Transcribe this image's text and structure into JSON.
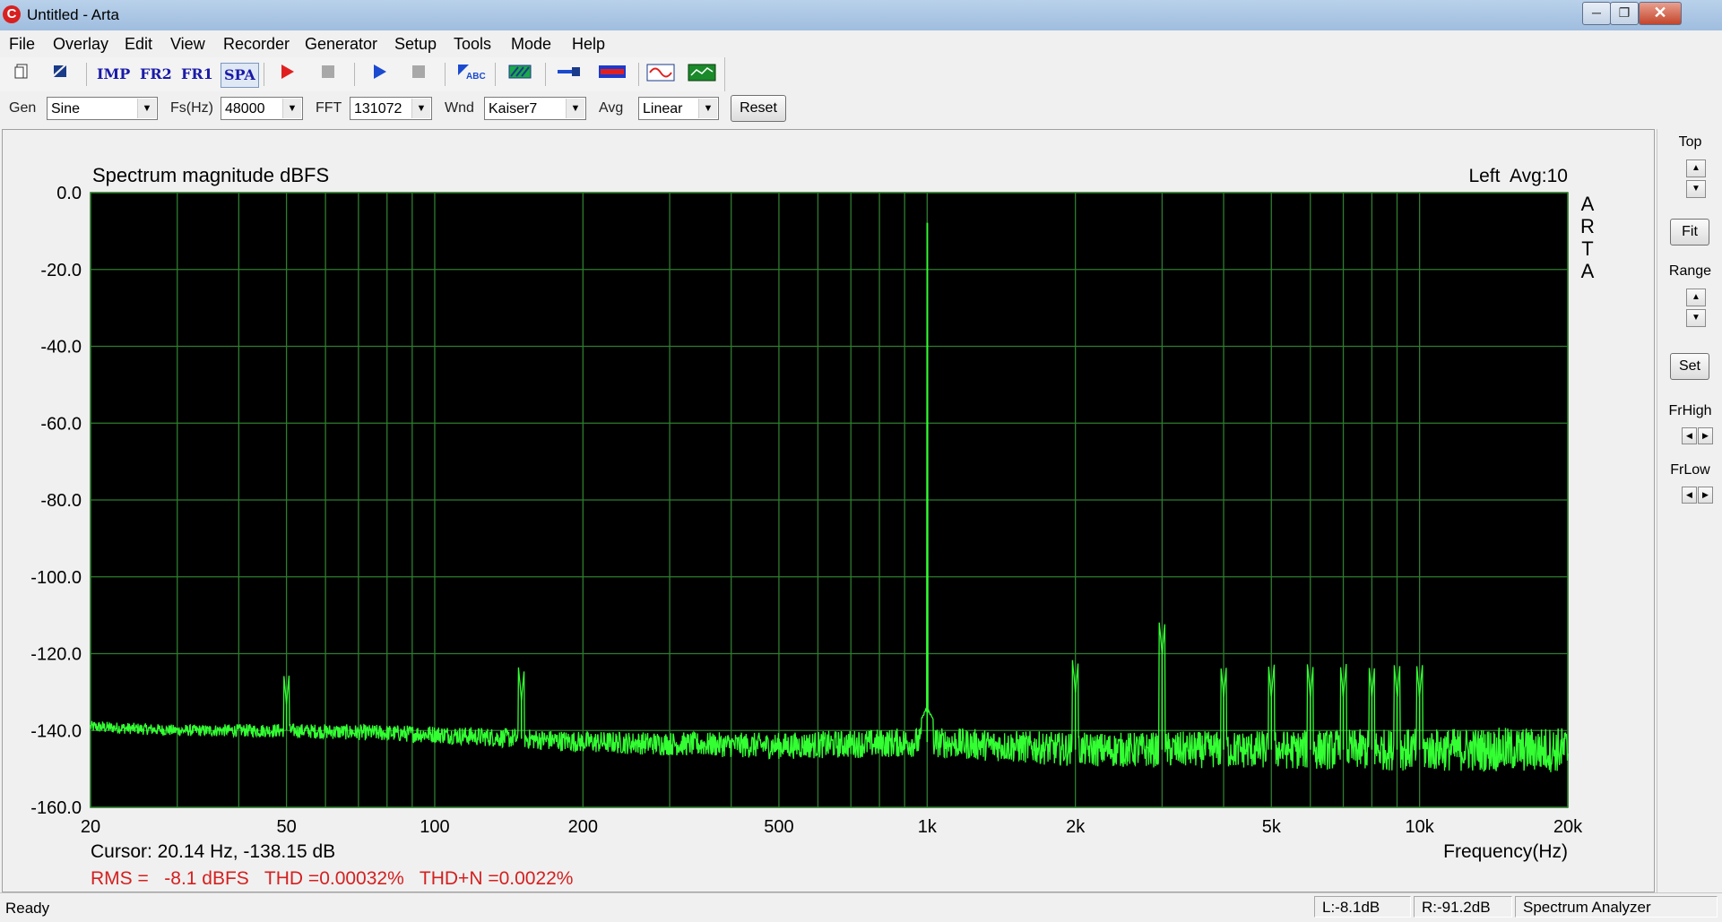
{
  "window": {
    "app_icon": "arta-icon",
    "title": "Untitled - Arta",
    "buttons": [
      "minimize",
      "restore",
      "close"
    ]
  },
  "menu": [
    "File",
    "Overlay",
    "Edit",
    "View",
    "Recorder",
    "Generator",
    "Setup",
    "Tools",
    "Mode",
    "Help"
  ],
  "toolbar": {
    "icons": [
      "new-file-icon",
      "open-icon",
      "imp-mode-icon",
      "fr2-mode-icon",
      "fr1-mode-icon",
      "spa-mode-icon",
      "record-icon",
      "stop-icon",
      "play-icon",
      "stop-icon",
      "abc-icon",
      "hatch-icon",
      "probe-icon",
      "spectrum-icon",
      "sine-icon",
      "scope-icon"
    ],
    "imp_label": "IMP",
    "fr2_label": "FR2",
    "fr1_label": "FR1",
    "spa_label": "SPA",
    "abc_label": "ABC"
  },
  "params": {
    "gen_label": "Gen",
    "gen_value": "Sine",
    "fs_label": "Fs(Hz)",
    "fs_value": "48000",
    "fft_label": "FFT",
    "fft_value": "131072",
    "wnd_label": "Wnd",
    "wnd_value": "Kaiser7",
    "avg_label": "Avg",
    "avg_value": "Linear",
    "reset_label": "Reset"
  },
  "right_panel": {
    "top_label": "Top",
    "fit_label": "Fit",
    "range_label": "Range",
    "set_label": "Set",
    "frhigh_label": "FrHigh",
    "frlow_label": "FrLow"
  },
  "chart_data": {
    "type": "line",
    "title": "Spectrum magnitude dBFS",
    "channel_info": "Left  Avg:10",
    "watermark": "ARTA",
    "xlabel": "Frequency(Hz)",
    "x_scale": "log",
    "xlim": [
      20,
      20000
    ],
    "ylim": [
      -160,
      0
    ],
    "x_tick_values": [
      20,
      50,
      100,
      200,
      500,
      1000,
      2000,
      5000,
      10000,
      20000
    ],
    "x_tick_labels": [
      "20",
      "50",
      "100",
      "200",
      "500",
      "1k",
      "2k",
      "5k",
      "10k",
      "20k"
    ],
    "y_tick_values": [
      0,
      -20,
      -40,
      -60,
      -80,
      -100,
      -120,
      -140,
      -160
    ],
    "y_tick_labels": [
      "0.0",
      "-20.0",
      "-40.0",
      "-60.0",
      "-80.0",
      "-100.0",
      "-120.0",
      "-140.0",
      "-160.0"
    ],
    "grid": true,
    "background": "#000000",
    "grid_color": "#2e7d2e",
    "trace_color": "#33ff33",
    "series": [
      {
        "noise_floor": [
          [
            20,
            -139
          ],
          [
            30,
            -140
          ],
          [
            50,
            -140
          ],
          [
            100,
            -141
          ],
          [
            200,
            -143
          ],
          [
            500,
            -144
          ],
          [
            1000,
            -143
          ],
          [
            2000,
            -145
          ],
          [
            5000,
            -145
          ],
          [
            10000,
            -145
          ],
          [
            20000,
            -145
          ]
        ],
        "peaks": [
          [
            50,
            -133
          ],
          [
            150,
            -132
          ],
          [
            1000,
            -8
          ],
          [
            2000,
            -130
          ],
          [
            3000,
            -120
          ],
          [
            4000,
            -131
          ],
          [
            5000,
            -131
          ],
          [
            6000,
            -131
          ],
          [
            7000,
            -131
          ],
          [
            8000,
            -131
          ],
          [
            9000,
            -131
          ],
          [
            10000,
            -131
          ]
        ]
      }
    ],
    "cursor_text": "Cursor: 20.14 Hz, -138.15 dB",
    "stats_text": "RMS =   -8.1 dBFS   THD =0.00032%   THD+N =0.0022%",
    "stats_color": "#d42020"
  },
  "status": {
    "ready": "Ready",
    "left_level": "L:-8.1dB",
    "right_level": "R:-91.2dB",
    "mode": "Spectrum Analyzer"
  }
}
